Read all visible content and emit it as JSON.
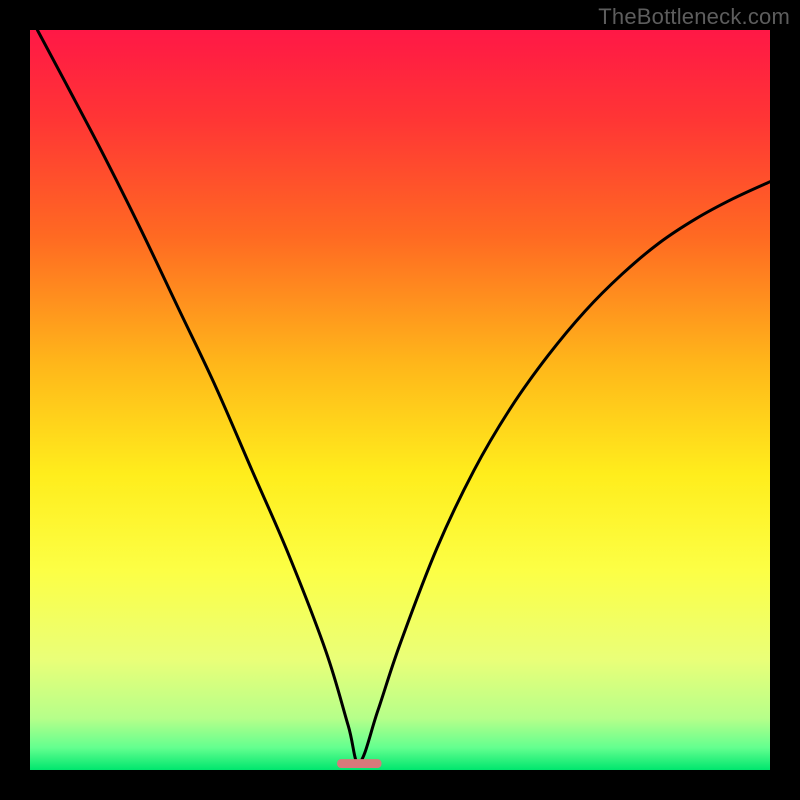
{
  "watermark": "TheBottleneck.com",
  "chart_data": {
    "type": "line",
    "title": "",
    "xlabel": "",
    "ylabel": "",
    "x_range": [
      0,
      1
    ],
    "y_range": [
      0,
      1
    ],
    "minimum_x": 0.445,
    "marker": {
      "x_center": 0.445,
      "width": 0.06,
      "height": 0.012,
      "color": "#d77a7b"
    },
    "gradient_stops": [
      {
        "offset": 0.0,
        "color": "#ff1846"
      },
      {
        "offset": 0.12,
        "color": "#ff3535"
      },
      {
        "offset": 0.28,
        "color": "#ff6a22"
      },
      {
        "offset": 0.45,
        "color": "#ffb61a"
      },
      {
        "offset": 0.6,
        "color": "#ffed1c"
      },
      {
        "offset": 0.73,
        "color": "#fcff45"
      },
      {
        "offset": 0.85,
        "color": "#eaff78"
      },
      {
        "offset": 0.93,
        "color": "#b6ff8a"
      },
      {
        "offset": 0.97,
        "color": "#63ff8f"
      },
      {
        "offset": 1.0,
        "color": "#00e66e"
      }
    ],
    "curves": {
      "left": {
        "description": "steep descending branch from top-left to the minimum",
        "points": [
          {
            "x": 0.01,
            "y": 1.0
          },
          {
            "x": 0.05,
            "y": 0.925
          },
          {
            "x": 0.1,
            "y": 0.83
          },
          {
            "x": 0.15,
            "y": 0.73
          },
          {
            "x": 0.2,
            "y": 0.625
          },
          {
            "x": 0.25,
            "y": 0.52
          },
          {
            "x": 0.3,
            "y": 0.405
          },
          {
            "x": 0.35,
            "y": 0.29
          },
          {
            "x": 0.4,
            "y": 0.16
          },
          {
            "x": 0.43,
            "y": 0.06
          },
          {
            "x": 0.445,
            "y": 0.01
          }
        ]
      },
      "right": {
        "description": "ascending branch from the minimum toward the right, ending mid-height at right edge",
        "points": [
          {
            "x": 0.445,
            "y": 0.01
          },
          {
            "x": 0.47,
            "y": 0.08
          },
          {
            "x": 0.5,
            "y": 0.17
          },
          {
            "x": 0.55,
            "y": 0.3
          },
          {
            "x": 0.6,
            "y": 0.405
          },
          {
            "x": 0.65,
            "y": 0.49
          },
          {
            "x": 0.7,
            "y": 0.56
          },
          {
            "x": 0.75,
            "y": 0.62
          },
          {
            "x": 0.8,
            "y": 0.67
          },
          {
            "x": 0.85,
            "y": 0.712
          },
          {
            "x": 0.9,
            "y": 0.745
          },
          {
            "x": 0.95,
            "y": 0.772
          },
          {
            "x": 1.0,
            "y": 0.795
          }
        ]
      }
    }
  }
}
